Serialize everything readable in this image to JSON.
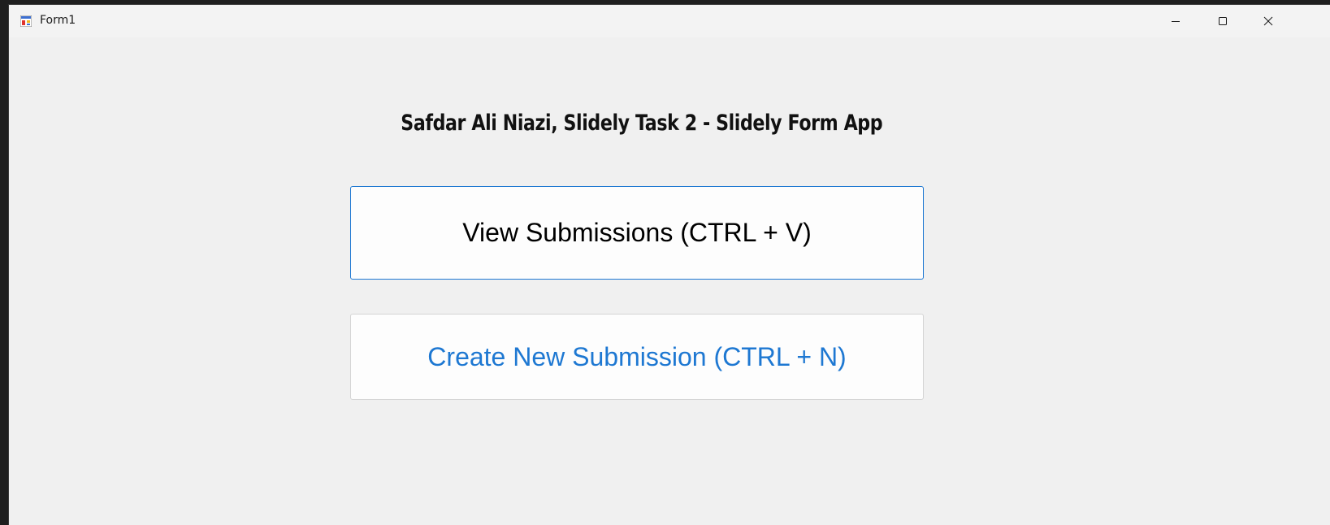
{
  "window": {
    "title": "Form1",
    "icons": {
      "app": "form-app-icon",
      "minimize": "minimize-icon",
      "maximize": "maximize-icon",
      "close": "close-icon"
    },
    "controls": {
      "minimize": "–",
      "maximize": "☐",
      "close": "✕"
    }
  },
  "main": {
    "heading": "Safdar Ali Niazi, Slidely Task 2 - Slidely Form App",
    "view_button_label": "View Submissions (CTRL + V)",
    "create_button_label": "Create New Submission (CTRL + N)"
  },
  "colors": {
    "accent": "#1e78d2",
    "background": "#f0f0f0"
  }
}
